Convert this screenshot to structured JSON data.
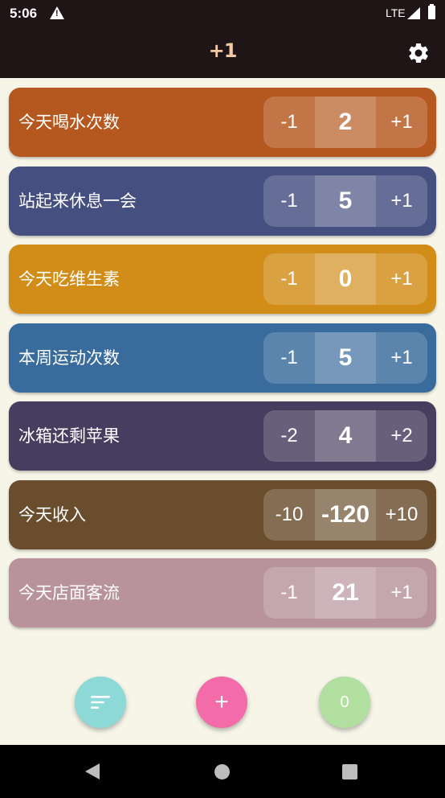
{
  "status": {
    "time": "5:06",
    "network": "LTE"
  },
  "appbar": {
    "title": "+1"
  },
  "counters": [
    {
      "label": "今天喝水次数",
      "dec": "-1",
      "value": "2",
      "inc": "+1",
      "color": "#b5581f"
    },
    {
      "label": "站起来休息一会",
      "dec": "-1",
      "value": "5",
      "inc": "+1",
      "color": "#454f80"
    },
    {
      "label": "今天吃维生素",
      "dec": "-1",
      "value": "0",
      "inc": "+1",
      "color": "#d18d18"
    },
    {
      "label": "本周运动次数",
      "dec": "-1",
      "value": "5",
      "inc": "+1",
      "color": "#396b9c"
    },
    {
      "label": "冰箱还剩苹果",
      "dec": "-2",
      "value": "4",
      "inc": "+2",
      "color": "#473d5e"
    },
    {
      "label": "今天收入",
      "dec": "-10",
      "value": "-120",
      "inc": "+10",
      "color": "#694d2d"
    },
    {
      "label": "今天店面客流",
      "dec": "-1",
      "value": "21",
      "inc": "+1",
      "color": "#b8939b"
    }
  ],
  "fabs": {
    "add_label": "+",
    "total_label": "0"
  },
  "colors": {
    "bar": "#1f1416",
    "background": "#f6f5e8",
    "title": "#f2c9a4",
    "fab_sort": "#8dd9d7",
    "fab_add": "#f36ba8",
    "fab_total": "#b1df9f"
  }
}
